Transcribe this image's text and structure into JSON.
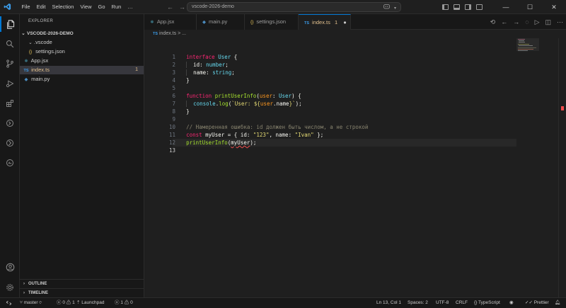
{
  "menu": [
    "File",
    "Edit",
    "Selection",
    "View",
    "Go",
    "Run"
  ],
  "menu_more": "…",
  "search": {
    "text": "vscode-2026-demo"
  },
  "sidebar": {
    "title": "EXPLORER",
    "root": "VSCODE-2026-DEMO",
    "items": [
      {
        "label": ".vscode",
        "icon": "chevron-down-icon"
      },
      {
        "label": "settings.json",
        "icon": "braces-icon"
      },
      {
        "label": "App.jsx",
        "icon": "react-icon"
      },
      {
        "label": "index.ts",
        "icon": "ts-icon",
        "badge": "1"
      },
      {
        "label": "main.py",
        "icon": "python-icon"
      }
    ],
    "outline": "OUTLINE",
    "timeline": "TIMELINE"
  },
  "tabs": [
    {
      "label": "App.jsx",
      "icon": "⚛"
    },
    {
      "label": "main.py",
      "icon": "◆"
    },
    {
      "label": "settings.json",
      "icon": "{}"
    },
    {
      "label": "index.ts",
      "icon": "TS",
      "badge": "1",
      "dirty": "●"
    }
  ],
  "breadcrumb": {
    "icon": "TS",
    "file": "index.ts",
    "sep": "> ..."
  },
  "code": {
    "line_numbers": [
      "1",
      "2",
      "3",
      "4",
      "5",
      "6",
      "7",
      "8",
      "9",
      "10",
      "11",
      "12",
      "13"
    ],
    "l1": {
      "kw": "interface",
      "name": "User",
      "brace": " {"
    },
    "l2": {
      "prop": "id",
      "colon": ": ",
      "type": "number",
      "end": ";"
    },
    "l3": {
      "prop": "name",
      "colon": ": ",
      "type": "string",
      "end": ";"
    },
    "l4": "}",
    "l6": {
      "kw": "function",
      "name": "printUserInfo",
      "open": "(",
      "param": "user",
      "colon": ": ",
      "type": "User",
      "close": ") {"
    },
    "l7": {
      "obj": "console",
      "dot": ".",
      "fn": "log",
      "open": "(",
      "str1": "`User: ${",
      "param": "user",
      "dot2": ".",
      "prop": "name",
      "str2": "}`",
      "close": ");"
    },
    "l8": "}",
    "l10": "// Намеренная ошибка: id должен быть числом, а не строкой",
    "l11": {
      "kw": "const",
      "name": "myUser",
      "eq": " = { ",
      "p1": "id",
      "c1": ": ",
      "v1": "\"123\"",
      "comma": ", ",
      "p2": "name",
      "c2": ": ",
      "v2": "\"Ivan\"",
      "end": " };"
    },
    "l12": {
      "fn": "printUserInfo",
      "open": "(",
      "arg": "myUser",
      "close": ");"
    }
  },
  "status": {
    "branch": "master",
    "errors": "0",
    "warnings": "1",
    "launchpad": "Launchpad",
    "problems_errors": "1",
    "problems_warnings": "0",
    "ln_col": "Ln 13, Col 1",
    "spaces": "Spaces: 2",
    "encoding": "UTF-8",
    "eol": "CRLF",
    "language": "TypeScript",
    "prettier": "Prettier"
  },
  "colors": {
    "accent": "#0078d4",
    "error": "#f14c4c",
    "warning_badge": "#e2c08d"
  }
}
